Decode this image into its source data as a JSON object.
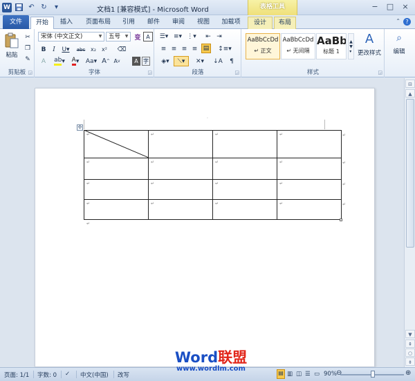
{
  "titlebar": {
    "title": "文档1 [兼容模式] - Microsoft Word",
    "context_group": "表格工具",
    "qat_icons": [
      "word-logo-icon",
      "save-icon",
      "undo-icon",
      "redo-icon",
      "customize-qat-icon"
    ],
    "word_logo": "W"
  },
  "tabs": [
    {
      "label": "文件"
    },
    {
      "label": "开始"
    },
    {
      "label": "插入"
    },
    {
      "label": "页面布局"
    },
    {
      "label": "引用"
    },
    {
      "label": "邮件"
    },
    {
      "label": "审阅"
    },
    {
      "label": "视图"
    },
    {
      "label": "加载项"
    },
    {
      "label": "设计"
    },
    {
      "label": "布局"
    }
  ],
  "ribbon": {
    "clipboard": {
      "label": "剪贴板",
      "paste": "粘贴"
    },
    "font": {
      "label": "字体",
      "font_name": "宋体 (中文正文)",
      "font_size": "五号"
    },
    "paragraph": {
      "label": "段落"
    },
    "styles": {
      "label": "样式",
      "items": [
        {
          "sample": "AaBbCcDd",
          "name": "↵ 正文"
        },
        {
          "sample": "AaBbCcDd",
          "name": "↵ 无间隔"
        },
        {
          "sample": "AaBb",
          "name": "标题 1"
        }
      ],
      "change_styles": "更改样式"
    },
    "editing": {
      "label": "编辑"
    }
  },
  "document": {
    "para_mark": "↵",
    "table": {
      "rows": 4,
      "cols": 4
    }
  },
  "statusbar": {
    "page": "页面: 1/1",
    "words": "字数: 0",
    "language": "中文(中国)",
    "mode": "改写",
    "zoom": "90%"
  },
  "watermark": {
    "brand_word": "Word",
    "brand_cn": "联盟",
    "url": "www.wordlm.com"
  },
  "colors": {
    "file_tab": "#2a5aa7",
    "context_tab": "#efe07a",
    "watermark_blue": "#1a4fc4",
    "watermark_red": "#e2261a"
  }
}
